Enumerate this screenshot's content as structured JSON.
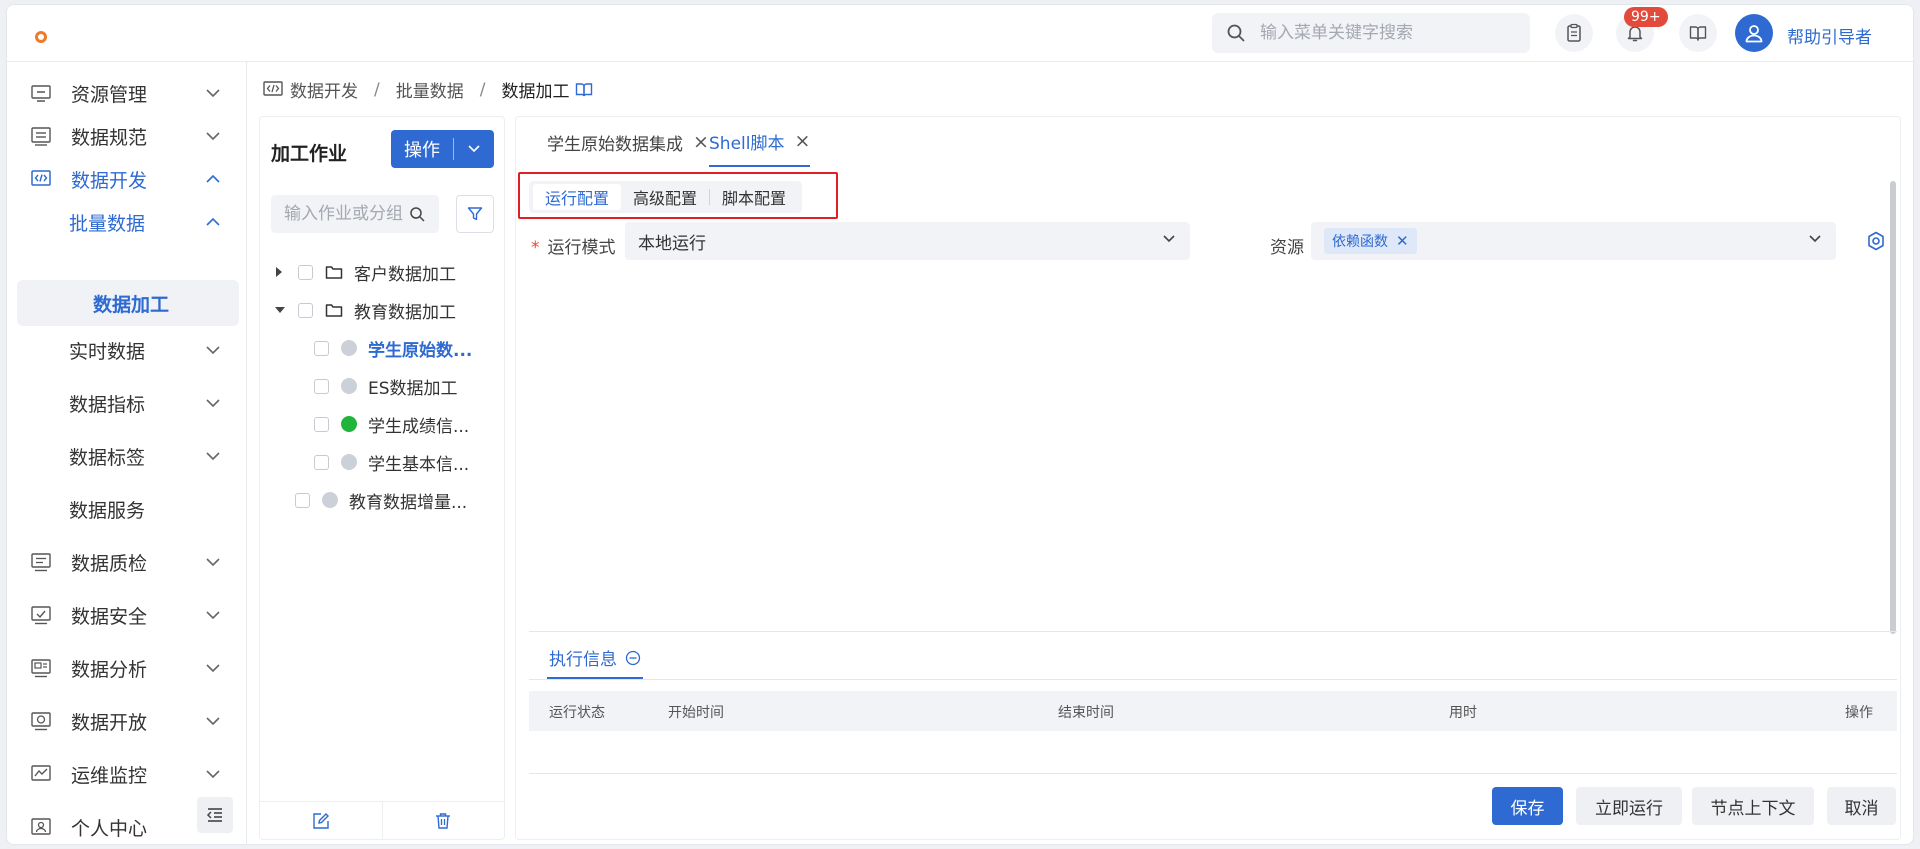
{
  "header": {
    "search_placeholder": "输入菜单关键字搜索",
    "notification_count": "99+",
    "username": "帮助引导者"
  },
  "sidebar": {
    "items": [
      {
        "label": "资源管理"
      },
      {
        "label": "数据规范"
      },
      {
        "label": "数据开发"
      },
      {
        "label": "批量数据"
      },
      {
        "label": "数据加工"
      },
      {
        "label": "实时数据"
      },
      {
        "label": "数据指标"
      },
      {
        "label": "数据标签"
      },
      {
        "label": "数据服务"
      },
      {
        "label": "数据质检"
      },
      {
        "label": "数据安全"
      },
      {
        "label": "数据分析"
      },
      {
        "label": "数据开放"
      },
      {
        "label": "运维监控"
      },
      {
        "label": "个人中心"
      }
    ]
  },
  "breadcrumb": {
    "items": [
      "数据开发",
      "批量数据",
      "数据加工"
    ],
    "separator": "/"
  },
  "jobs": {
    "title": "加工作业",
    "operate_label": "操作",
    "search_placeholder": "输入作业或分组",
    "tree": [
      {
        "label": "客户数据加工"
      },
      {
        "label": "教育数据加工"
      },
      {
        "label": "学生原始数..."
      },
      {
        "label": "ES数据加工"
      },
      {
        "label": "学生成绩信..."
      },
      {
        "label": "学生基本信..."
      },
      {
        "label": "教育数据增量..."
      }
    ]
  },
  "main": {
    "tabs": [
      {
        "label": "学生原始数据集成"
      },
      {
        "label": "Shell脚本"
      }
    ],
    "config_tabs": [
      "运行配置",
      "高级配置",
      "脚本配置"
    ],
    "run_mode": {
      "label": "运行模式",
      "value": "本地运行"
    },
    "resource": {
      "label": "资源",
      "tag": "依赖函数"
    },
    "exec_info": {
      "title": "执行信息",
      "columns": [
        "运行状态",
        "开始时间",
        "结束时间",
        "用时",
        "操作"
      ]
    },
    "buttons": {
      "save": "保存",
      "run": "立即运行",
      "context": "节点上下文",
      "cancel": "取消"
    }
  },
  "colors": {
    "primary": "#2e6ad1",
    "highlight_box": "#e01f25",
    "status_green": "#1fb53a"
  }
}
